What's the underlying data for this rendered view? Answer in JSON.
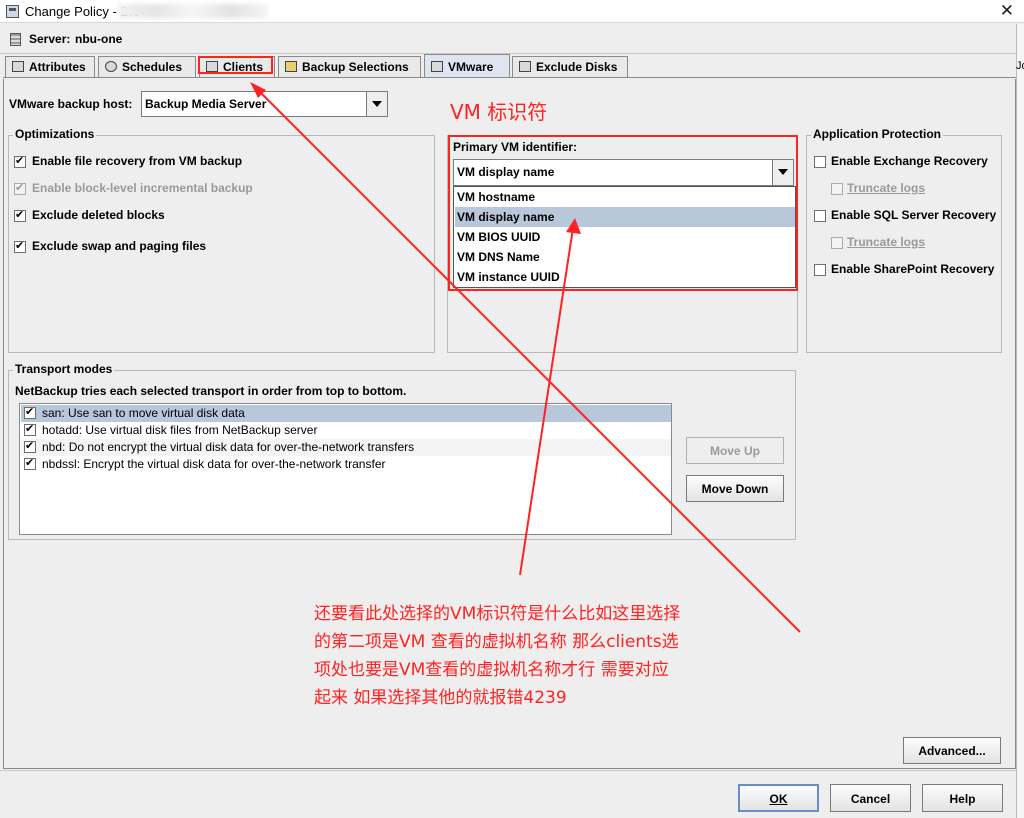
{
  "window": {
    "title": "Change Policy - BK",
    "close_glyph": "✕"
  },
  "server": {
    "label": "Server:",
    "value": "nbu-one"
  },
  "right_fragment": "Jo",
  "tabs": [
    {
      "label": "Attributes",
      "icon": "attributes-icon"
    },
    {
      "label": "Schedules",
      "icon": "schedules-icon"
    },
    {
      "label": "Clients",
      "icon": "clients-icon"
    },
    {
      "label": "Backup Selections",
      "icon": "backup-selections-icon"
    },
    {
      "label": "VMware",
      "icon": "vmware-icon",
      "active": true
    },
    {
      "label": "Exclude Disks",
      "icon": "exclude-disks-icon"
    }
  ],
  "vmware": {
    "backup_host_label": "VMware backup host:",
    "backup_host_value": "Backup Media Server",
    "optimizations": {
      "title": "Optimizations",
      "items": [
        {
          "label": "Enable file recovery from VM backup",
          "checked": true,
          "enabled": true
        },
        {
          "label": "Enable block-level incremental backup",
          "checked": true,
          "enabled": false
        },
        {
          "label": "Exclude deleted blocks",
          "checked": true,
          "enabled": true
        },
        {
          "label": "Exclude swap and paging files",
          "checked": true,
          "enabled": true
        }
      ]
    },
    "primary_identifier": {
      "label": "Primary VM identifier:",
      "value": "VM display name",
      "options": [
        "VM hostname",
        "VM display name",
        "VM BIOS UUID",
        "VM DNS Name",
        "VM instance UUID"
      ],
      "selected_index": 1
    },
    "app_protection": {
      "title": "Application Protection",
      "exchange": "Enable Exchange Recovery",
      "exchange_truncate": "Truncate logs",
      "sql": "Enable SQL Server Recovery",
      "sql_truncate": "Truncate logs",
      "sharepoint": "Enable SharePoint Recovery"
    },
    "transport": {
      "title": "Transport modes",
      "description": "NetBackup tries each selected transport in order from top to bottom.",
      "modes": [
        {
          "text": "san: Use san to move virtual disk data",
          "checked": true,
          "selected": true
        },
        {
          "text": "hotadd: Use virtual disk files from NetBackup server",
          "checked": true
        },
        {
          "text": "nbd: Do not encrypt the virtual disk data for over-the-network transfers",
          "checked": true
        },
        {
          "text": "nbdssl: Encrypt the virtual disk data for over-the-network transfer",
          "checked": true
        }
      ],
      "move_up": "Move Up",
      "move_down": "Move Down"
    },
    "advanced": "Advanced..."
  },
  "buttons": {
    "ok": "OK",
    "cancel": "Cancel",
    "help": "Help"
  },
  "annotations": {
    "vm_identifier": "VM 标识符",
    "note_lines": [
      "还要看此处选择的VM标识符是什么比如这里选择",
      "的第二项是VM 查看的虚拟机名称 那么clients选",
      "项处也要是VM查看的虚拟机名称才行  需要对应",
      "起来 如果选择其他的就报错4239"
    ],
    "color": "#ff2222"
  }
}
